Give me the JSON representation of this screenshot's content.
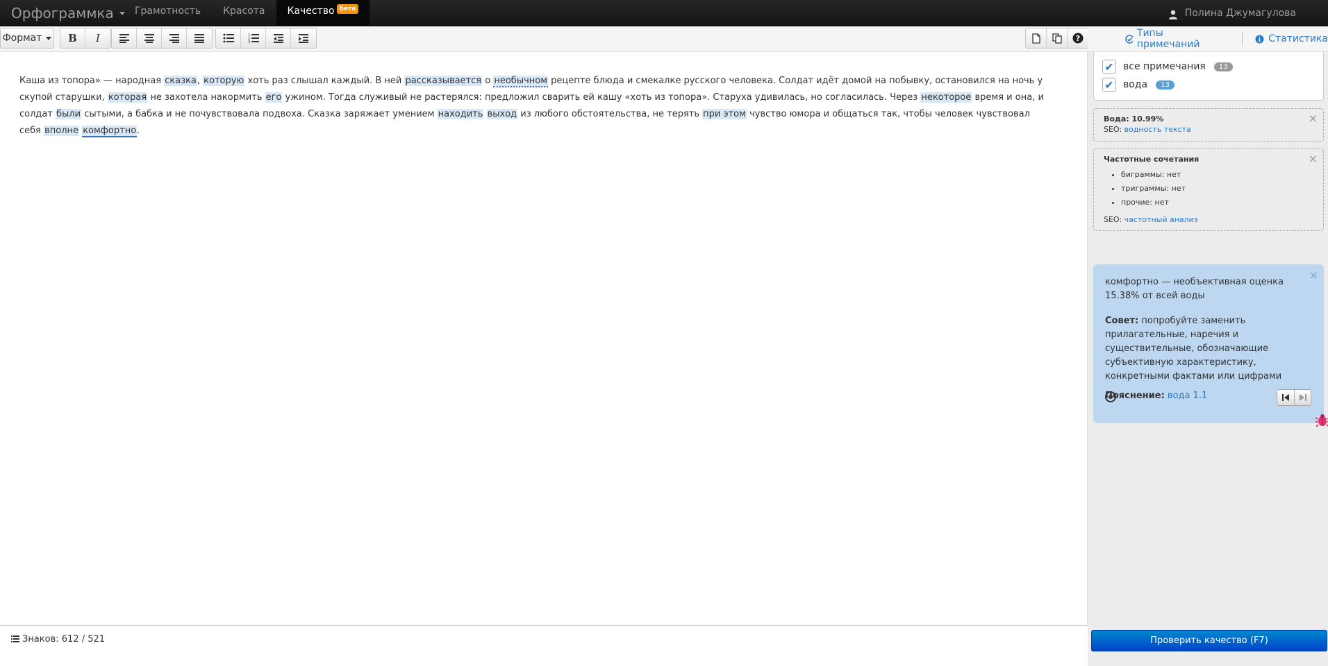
{
  "app": {
    "brand": "Орфограммка"
  },
  "nav": {
    "tabs": [
      {
        "label": "Грамотность"
      },
      {
        "label": "Красота"
      },
      {
        "label": "Качество",
        "badge": "бета",
        "active": true
      }
    ],
    "user_name": "Полина Джумагулова"
  },
  "toolbar": {
    "format_label": "Формат"
  },
  "text": {
    "segments": [
      {
        "t": "Каша из топора» — народная "
      },
      {
        "t": "сказка",
        "hl": "1"
      },
      {
        "t": ", "
      },
      {
        "t": "которую",
        "hl": "1"
      },
      {
        "t": " хоть раз слышал каждый. В ней "
      },
      {
        "t": "рассказывается",
        "hl": "1"
      },
      {
        "t": " о "
      },
      {
        "t": "необычном",
        "hl": "dot"
      },
      {
        "t": " рецепте блюда и смекалке русского человека. Солдат идёт домой на побывку, остановился на ночь у скупой старушки, "
      },
      {
        "t": "которая",
        "hl": "1"
      },
      {
        "t": " не захотела накормить "
      },
      {
        "t": "его",
        "hl": "1"
      },
      {
        "t": " ужином. Тогда служивый не растерялся: предложил сварить ей кашу «хоть из топора». Старуха удивилась, но согласилась. Через "
      },
      {
        "t": "некоторое",
        "hl": "1"
      },
      {
        "t": " время и она, и солдат "
      },
      {
        "t": "были",
        "hl": "1"
      },
      {
        "t": " сытыми, а бабка и не почувствовала подвоха. Сказка заряжает умением "
      },
      {
        "t": "находить",
        "hl": "1"
      },
      {
        "t": " "
      },
      {
        "t": "выход",
        "hl": "1"
      },
      {
        "t": " из любого обстоятельства, не терять "
      },
      {
        "t": "при этом",
        "hl": "1"
      },
      {
        "t": " чувство юмора и общаться так, чтобы человек чувствовал себя "
      },
      {
        "t": "вполне",
        "hl": "1"
      },
      {
        "t": " "
      },
      {
        "t": "комфортно",
        "hl": "sel"
      },
      {
        "t": "."
      }
    ]
  },
  "status": {
    "chars": "Знаков: 612 / 521"
  },
  "sidebar": {
    "tab_types": "Типы примечаний",
    "tab_stats": "Статистика",
    "filters": [
      {
        "label": "все примечания",
        "count": "13",
        "color": "gray"
      },
      {
        "label": "вода",
        "count": "13",
        "color": "blue"
      }
    ],
    "water": {
      "title": "Вода: 10.99%",
      "seo_prefix": "SEO: ",
      "seo_link": "водность текста"
    },
    "freq": {
      "title": "Частотные сочетания",
      "items": [
        "биграммы: нет",
        "триграммы: нет",
        "прочие: нет"
      ],
      "seo_prefix": "SEO: ",
      "seo_link": "частотный анализ"
    },
    "tip": {
      "word": "комфортно",
      "headline_rest": " — необъективная оценка",
      "percent": "15.38% от всей воды",
      "advice_label": "Совет:",
      "advice": " попробуйте заменить прилагательные, наречия и существительные, обозначающие субъективную характеристику, конкретными фактами или цифрами",
      "explain_label": "Пояснение:",
      "explain_link": "вода 1.1"
    }
  },
  "actions": {
    "check_label": "Проверить качество (F7)"
  }
}
